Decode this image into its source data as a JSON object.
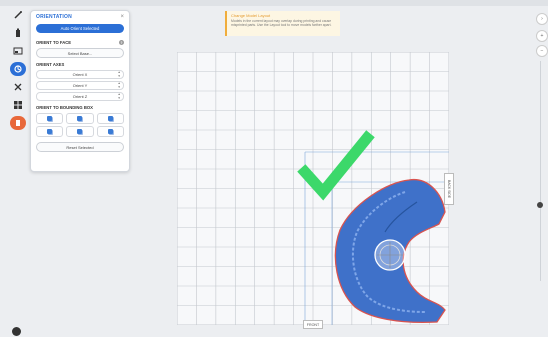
{
  "panel": {
    "title": "ORIENTATION",
    "close_glyph": "×",
    "auto_orient_label": "Auto Orient Selected",
    "orient_to_face_heading": "ORIENT TO FACE",
    "help_glyph": "?",
    "select_base_label": "Select Base...",
    "orient_axes_heading": "ORIENT AXES",
    "axes": [
      {
        "label": "Orient X"
      },
      {
        "label": "Orient Y"
      },
      {
        "label": "Orient Z"
      }
    ],
    "bbox_heading": "ORIENT TO BOUNDING BOX",
    "reset_label": "Reset Selected"
  },
  "notice": {
    "title": "Change Model Layout",
    "body": "Models in the current layout may overlap during printing and cause misprinted parts. Use the Layout tool to move models farther apart."
  },
  "canvas": {
    "front_label": "FRONT",
    "back_label": "BACK SIDE",
    "grid_cols": 14,
    "grid_rows": 14
  },
  "colors": {
    "accent": "#2b6fd6",
    "warning": "#f0ad3c",
    "check": "#3cd86a",
    "model": "#3f71c9",
    "model_edge": "#d9534f",
    "tool_orange": "#e8683a"
  },
  "toolbar": {
    "icons": [
      "magic-wand-icon",
      "resin-bottle-icon",
      "layout-icon",
      "orientation-icon",
      "support-icon",
      "grid-icon",
      "print-icon"
    ]
  },
  "rightbar": {
    "collapse_glyph": "›",
    "zoom_in_glyph": "+",
    "zoom_out_glyph": "−"
  }
}
